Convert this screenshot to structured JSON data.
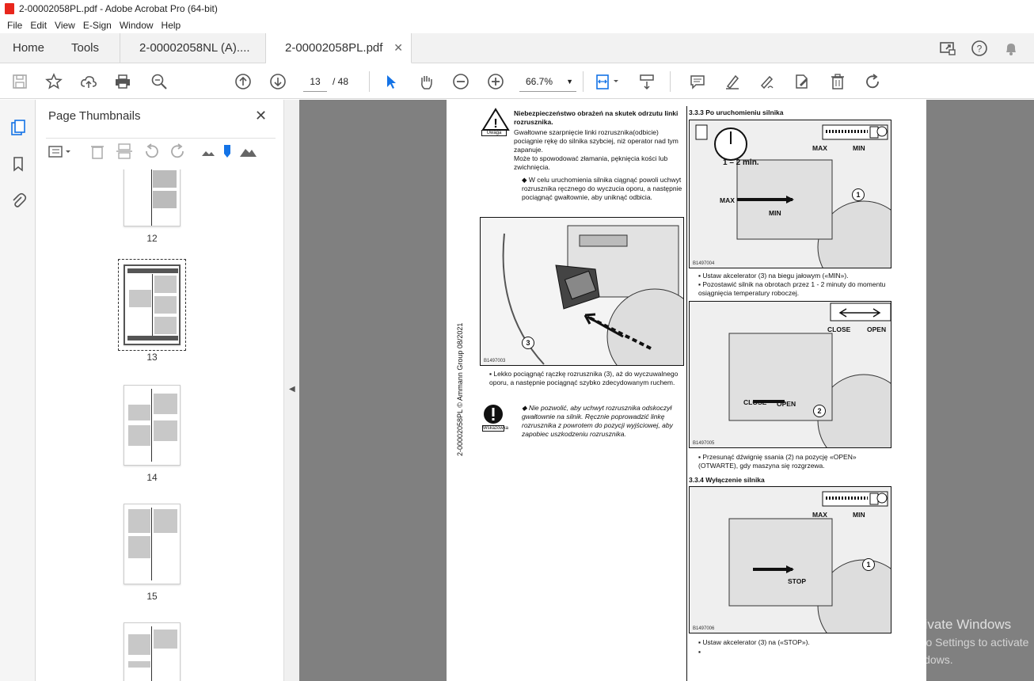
{
  "window": {
    "title": "2-00002058PL.pdf - Adobe Acrobat Pro (64-bit)"
  },
  "menu": [
    "File",
    "Edit",
    "View",
    "E-Sign",
    "Window",
    "Help"
  ],
  "tabs": {
    "home": "Home",
    "tools": "Tools",
    "doc1": "2-00002058NL (A)....",
    "doc2": "2-00002058PL.pdf"
  },
  "toolbar": {
    "page_current": "13",
    "page_total": "/ 48",
    "zoom": "66.7%"
  },
  "panel": {
    "title": "Page Thumbnails",
    "pages": [
      "12",
      "13",
      "14",
      "15"
    ]
  },
  "document": {
    "side_text": "2-00002058PL © Ammann Group 08/2021",
    "warn_label_1": "Uwaga",
    "warn_label_2": "Wskazówka",
    "warn_title": "Niebezpieczeństwo obrażeń na skutek odrzutu linki rozrusznika.",
    "warn_body_1": "Gwałtowne szarpnięcie linki rozrusznika(odbicie) pociągnie rękę do silnika szybciej, niż operator nad tym zapanuje.",
    "warn_body_2": "Może to spowodować złamania, pęknięcia kości lub zwichnięcia.",
    "warn_bullet": "W celu uruchomienia silnika ciągnąć powoli uchwyt rozrusznika ręcznego do wyczucia oporu, a następnie pociągnąć gwałtownie, aby uniknąć odbicia.",
    "img1_code": "B1497003",
    "callout_3": "3",
    "step_bullet": "Lekko pociągnąć rączkę rozrusznika (3), aż do wyczuwalnego oporu, a następnie pociągnąć szybko zdecydowanym ruchem.",
    "note_text": "Nie pozwolić, aby uchwyt rozrusznika odskoczył gwałtownie na silnik. Ręcznie poprowadzić linkę rozrusznika z powrotem do pozycji wyjściowej, aby zapobiec uszkodzeniu rozrusznika.",
    "sec_333": "3.3.3  Po uruchomieniu silnika",
    "img2_code": "B1497004",
    "img2_time": "1 – 2 min.",
    "label_max": "MAX",
    "label_min": "MIN",
    "label_stop": "STOP",
    "callout_1": "1",
    "bullet_min": "Ustaw akcelerator (3) na biegu jałowym («MIN»).",
    "bullet_warm": "Pozostawić silnik na obrotach przez 1 - 2 minuty do momentu osiągnięcia temperatury roboczej.",
    "img3_code": "B1497005",
    "label_close": "CLOSE",
    "label_open": "OPEN",
    "callout_2": "2",
    "bullet_choke": "Przesunąć dźwignię ssania (2) na pozycję «OPEN» (OTWARTE), gdy maszyna się rozgrzewa.",
    "sec_334": "3.3.4  Wyłączenie silnika",
    "img4_code": "B1497006",
    "bullet_stop": "Ustaw akcelerator (3) na («STOP»)."
  },
  "watermark": {
    "line1": "Activate Windows",
    "line2": "Go to Settings to activate Windows."
  }
}
